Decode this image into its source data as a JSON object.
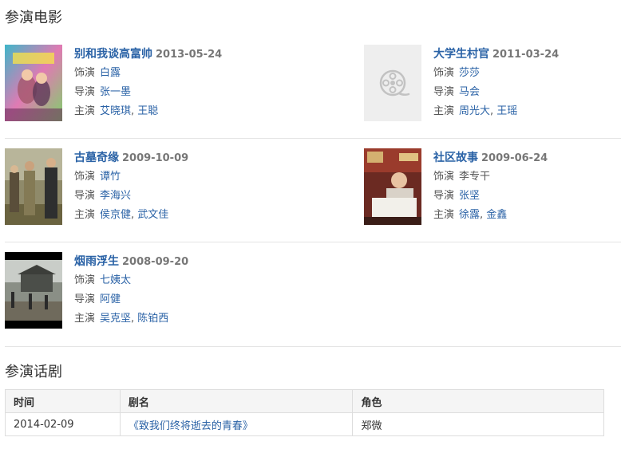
{
  "films_section": {
    "title": "参演电影"
  },
  "labels": {
    "role": "饰演",
    "director": "导演",
    "cast": "主演"
  },
  "films": [
    {
      "title": "别和我谈高富帅",
      "date": "2013-05-24",
      "role": "白露",
      "director": "张一墨",
      "cast": [
        "艾晓琪",
        "王聪"
      ],
      "poster": "poster-image"
    },
    {
      "title": "大学生村官",
      "date": "2011-03-24",
      "role": "莎莎",
      "director": "马会",
      "cast": [
        "周光大",
        "王瑶"
      ],
      "poster": "film-reel-icon"
    },
    {
      "title": "古墓奇缘",
      "date": "2009-10-09",
      "role": "谭竹",
      "director": "李海兴",
      "cast": [
        "侯京健",
        "武文佳"
      ],
      "poster": "poster-image"
    },
    {
      "title": "社区故事",
      "date": "2009-06-24",
      "role": "李专干",
      "director": "张坚",
      "cast": [
        "徐露",
        "金鑫"
      ],
      "poster": "poster-image"
    },
    {
      "title": "烟雨浮生",
      "date": "2008-09-20",
      "role": "七姨太",
      "director": "阿健",
      "cast": [
        "吴克坚",
        "陈铂西"
      ],
      "poster": "poster-image"
    }
  ],
  "drama_section": {
    "title": "参演话剧"
  },
  "drama_table": {
    "headers": [
      "时间",
      "剧名",
      "角色"
    ],
    "rows": [
      {
        "time": "2014-02-09",
        "name": "《致我们终将逝去的青春》",
        "role": "郑微"
      }
    ]
  },
  "colors": {
    "link": "#2a62a6",
    "date": "#777777",
    "border": "#e5e5e5",
    "header_bg": "#f5f5f5"
  }
}
